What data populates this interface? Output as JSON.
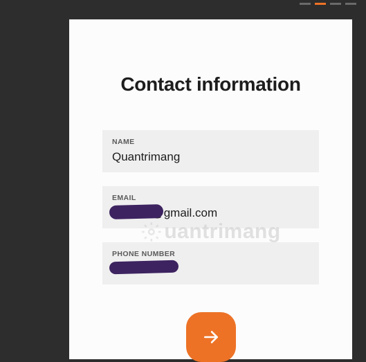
{
  "progress": {
    "total": 4,
    "active_index": 1
  },
  "title": "Contact information",
  "fields": {
    "name": {
      "label": "NAME",
      "value": "Quantrimang"
    },
    "email": {
      "label": "EMAIL",
      "value_visible_suffix": "4@gmail.com"
    },
    "phone": {
      "label": "PHONE NUMBER",
      "value_visible": ""
    }
  },
  "watermark_text": "uantrimang",
  "next_button_aria": "Next"
}
